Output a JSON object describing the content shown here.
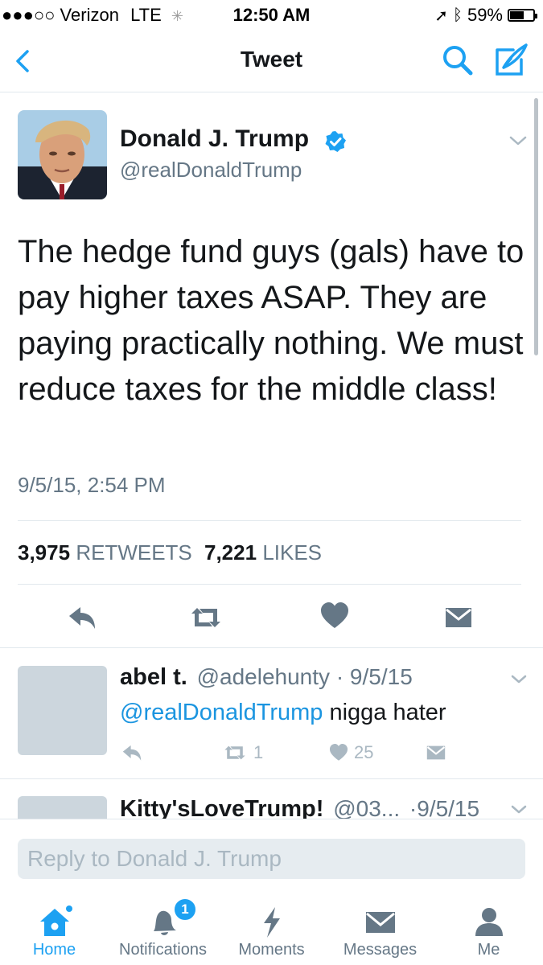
{
  "status_bar": {
    "carrier": "●●●○○ Verizon",
    "network": "LTE",
    "time": "12:50 AM",
    "battery": "59%",
    "battery_level": 0.59
  },
  "nav": {
    "title": "Tweet",
    "back_icon": "chevron-left-icon",
    "search_icon": "search-icon",
    "compose_icon": "compose-icon"
  },
  "tweet": {
    "author_name": "Donald J. Trump",
    "author_handle": "@realDonaldTrump",
    "verified": true,
    "text": "The hedge fund guys (gals) have to pay higher taxes ASAP. They are paying practically nothing. We must reduce taxes for the middle class!",
    "timestamp": "9/5/15, 2:54 PM",
    "retweet_count": "3,975",
    "retweet_label": "RETWEETS",
    "like_count": "7,221",
    "like_label": "LIKES"
  },
  "replies": [
    {
      "name": "abel t.",
      "handle": "@adelehunty",
      "date": "· 9/5/15",
      "mention": "@realDonaldTrump",
      "text": " nigga hater",
      "retweets": "1",
      "likes": "25"
    },
    {
      "name": "Kitty'sLoveTrump!",
      "handle": "@03...",
      "date": "·9/5/15"
    }
  ],
  "reply_bar": {
    "placeholder": "Reply to Donald J. Trump"
  },
  "tabs": [
    {
      "label": "Home",
      "icon": "home-icon",
      "active": true
    },
    {
      "label": "Notifications",
      "icon": "bell-icon",
      "badge": "1"
    },
    {
      "label": "Moments",
      "icon": "lightning-icon"
    },
    {
      "label": "Messages",
      "icon": "envelope-icon"
    },
    {
      "label": "Me",
      "icon": "person-icon"
    }
  ],
  "colors": {
    "accent": "#1da1f2",
    "text": "#14171a",
    "secondary": "#657786",
    "icon_gray": "#657786"
  }
}
